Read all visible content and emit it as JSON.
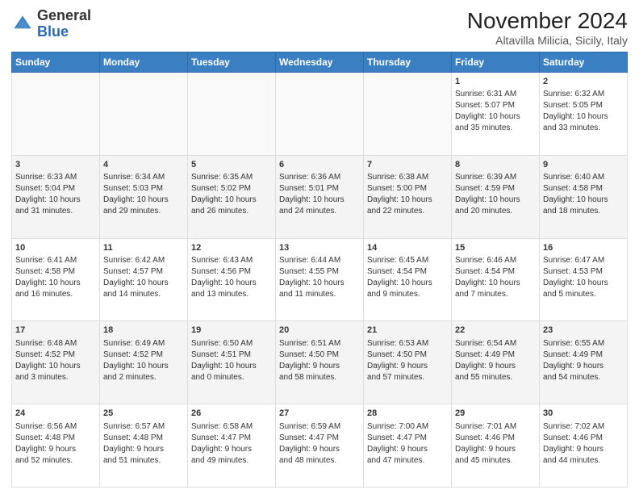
{
  "header": {
    "logo_line1": "General",
    "logo_line2": "Blue",
    "month_year": "November 2024",
    "location": "Altavilla Milicia, Sicily, Italy"
  },
  "weekdays": [
    "Sunday",
    "Monday",
    "Tuesday",
    "Wednesday",
    "Thursday",
    "Friday",
    "Saturday"
  ],
  "weeks": [
    [
      {
        "day": "",
        "info": ""
      },
      {
        "day": "",
        "info": ""
      },
      {
        "day": "",
        "info": ""
      },
      {
        "day": "",
        "info": ""
      },
      {
        "day": "",
        "info": ""
      },
      {
        "day": "1",
        "info": "Sunrise: 6:31 AM\nSunset: 5:07 PM\nDaylight: 10 hours\nand 35 minutes."
      },
      {
        "day": "2",
        "info": "Sunrise: 6:32 AM\nSunset: 5:05 PM\nDaylight: 10 hours\nand 33 minutes."
      }
    ],
    [
      {
        "day": "3",
        "info": "Sunrise: 6:33 AM\nSunset: 5:04 PM\nDaylight: 10 hours\nand 31 minutes."
      },
      {
        "day": "4",
        "info": "Sunrise: 6:34 AM\nSunset: 5:03 PM\nDaylight: 10 hours\nand 29 minutes."
      },
      {
        "day": "5",
        "info": "Sunrise: 6:35 AM\nSunset: 5:02 PM\nDaylight: 10 hours\nand 26 minutes."
      },
      {
        "day": "6",
        "info": "Sunrise: 6:36 AM\nSunset: 5:01 PM\nDaylight: 10 hours\nand 24 minutes."
      },
      {
        "day": "7",
        "info": "Sunrise: 6:38 AM\nSunset: 5:00 PM\nDaylight: 10 hours\nand 22 minutes."
      },
      {
        "day": "8",
        "info": "Sunrise: 6:39 AM\nSunset: 4:59 PM\nDaylight: 10 hours\nand 20 minutes."
      },
      {
        "day": "9",
        "info": "Sunrise: 6:40 AM\nSunset: 4:58 PM\nDaylight: 10 hours\nand 18 minutes."
      }
    ],
    [
      {
        "day": "10",
        "info": "Sunrise: 6:41 AM\nSunset: 4:58 PM\nDaylight: 10 hours\nand 16 minutes."
      },
      {
        "day": "11",
        "info": "Sunrise: 6:42 AM\nSunset: 4:57 PM\nDaylight: 10 hours\nand 14 minutes."
      },
      {
        "day": "12",
        "info": "Sunrise: 6:43 AM\nSunset: 4:56 PM\nDaylight: 10 hours\nand 13 minutes."
      },
      {
        "day": "13",
        "info": "Sunrise: 6:44 AM\nSunset: 4:55 PM\nDaylight: 10 hours\nand 11 minutes."
      },
      {
        "day": "14",
        "info": "Sunrise: 6:45 AM\nSunset: 4:54 PM\nDaylight: 10 hours\nand 9 minutes."
      },
      {
        "day": "15",
        "info": "Sunrise: 6:46 AM\nSunset: 4:54 PM\nDaylight: 10 hours\nand 7 minutes."
      },
      {
        "day": "16",
        "info": "Sunrise: 6:47 AM\nSunset: 4:53 PM\nDaylight: 10 hours\nand 5 minutes."
      }
    ],
    [
      {
        "day": "17",
        "info": "Sunrise: 6:48 AM\nSunset: 4:52 PM\nDaylight: 10 hours\nand 3 minutes."
      },
      {
        "day": "18",
        "info": "Sunrise: 6:49 AM\nSunset: 4:52 PM\nDaylight: 10 hours\nand 2 minutes."
      },
      {
        "day": "19",
        "info": "Sunrise: 6:50 AM\nSunset: 4:51 PM\nDaylight: 10 hours\nand 0 minutes."
      },
      {
        "day": "20",
        "info": "Sunrise: 6:51 AM\nSunset: 4:50 PM\nDaylight: 9 hours\nand 58 minutes."
      },
      {
        "day": "21",
        "info": "Sunrise: 6:53 AM\nSunset: 4:50 PM\nDaylight: 9 hours\nand 57 minutes."
      },
      {
        "day": "22",
        "info": "Sunrise: 6:54 AM\nSunset: 4:49 PM\nDaylight: 9 hours\nand 55 minutes."
      },
      {
        "day": "23",
        "info": "Sunrise: 6:55 AM\nSunset: 4:49 PM\nDaylight: 9 hours\nand 54 minutes."
      }
    ],
    [
      {
        "day": "24",
        "info": "Sunrise: 6:56 AM\nSunset: 4:48 PM\nDaylight: 9 hours\nand 52 minutes."
      },
      {
        "day": "25",
        "info": "Sunrise: 6:57 AM\nSunset: 4:48 PM\nDaylight: 9 hours\nand 51 minutes."
      },
      {
        "day": "26",
        "info": "Sunrise: 6:58 AM\nSunset: 4:47 PM\nDaylight: 9 hours\nand 49 minutes."
      },
      {
        "day": "27",
        "info": "Sunrise: 6:59 AM\nSunset: 4:47 PM\nDaylight: 9 hours\nand 48 minutes."
      },
      {
        "day": "28",
        "info": "Sunrise: 7:00 AM\nSunset: 4:47 PM\nDaylight: 9 hours\nand 47 minutes."
      },
      {
        "day": "29",
        "info": "Sunrise: 7:01 AM\nSunset: 4:46 PM\nDaylight: 9 hours\nand 45 minutes."
      },
      {
        "day": "30",
        "info": "Sunrise: 7:02 AM\nSunset: 4:46 PM\nDaylight: 9 hours\nand 44 minutes."
      }
    ]
  ]
}
